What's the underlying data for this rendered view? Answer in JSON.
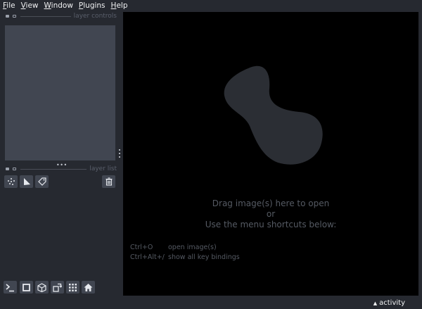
{
  "menubar": {
    "items": [
      {
        "label": "File"
      },
      {
        "label": "View"
      },
      {
        "label": "Window"
      },
      {
        "label": "Plugins"
      },
      {
        "label": "Help"
      }
    ]
  },
  "layer_controls": {
    "title": "layer controls"
  },
  "layer_list": {
    "title": "layer list"
  },
  "layer_buttons": [
    {
      "icon": "new-points-icon"
    },
    {
      "icon": "new-shapes-icon"
    },
    {
      "icon": "new-labels-icon"
    },
    {
      "icon": "delete-layer-icon"
    }
  ],
  "bottom_buttons": [
    {
      "icon": "console-icon"
    },
    {
      "icon": "ndisplay-2d-icon"
    },
    {
      "icon": "roll-dims-icon"
    },
    {
      "icon": "transpose-icon"
    },
    {
      "icon": "grid-icon"
    },
    {
      "icon": "home-icon"
    }
  ],
  "welcome": {
    "line1": "Drag image(s) here to open",
    "line2": "or",
    "line3": "Use the menu shortcuts below:",
    "shortcuts": [
      {
        "key": "Ctrl+O",
        "desc": "open image(s)"
      },
      {
        "key": "Ctrl+Alt+/",
        "desc": "show all key bindings"
      }
    ]
  },
  "status": {
    "activity_label": "activity",
    "activity_arrow": "▲"
  },
  "colors": {
    "background": "#262930",
    "panel": "#414651",
    "canvas": "#000000",
    "logo": "#2a2d33",
    "muted_text": "#555a63"
  }
}
